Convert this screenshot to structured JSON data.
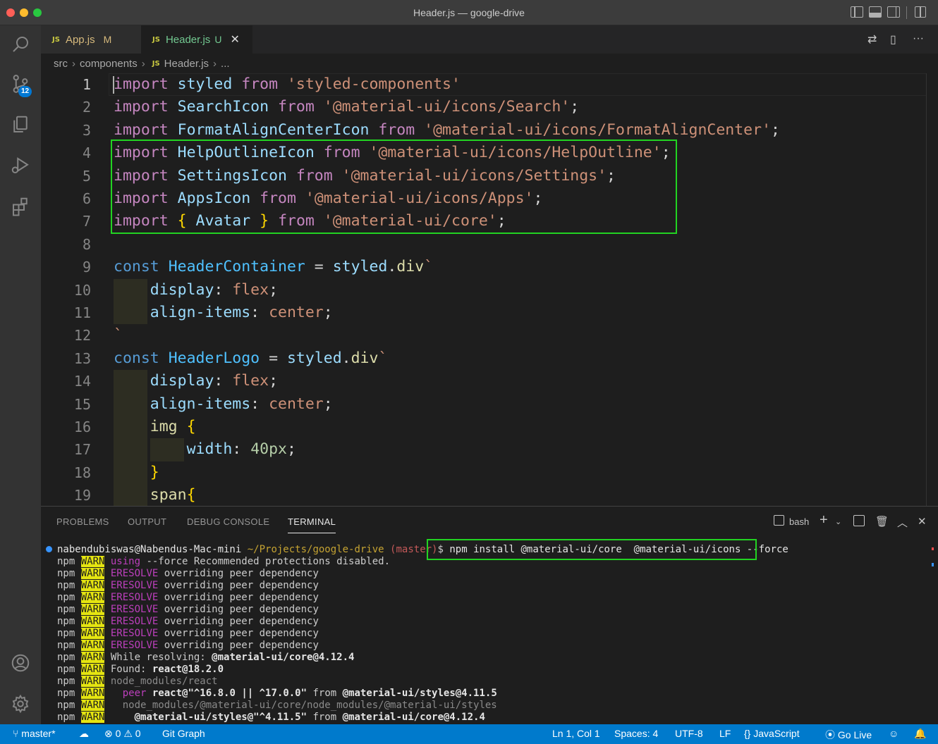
{
  "window": {
    "title": "Header.js — google-drive"
  },
  "activity_bar": {
    "items": [
      {
        "icon": "search-icon"
      },
      {
        "icon": "source-control-icon",
        "badge": "12"
      },
      {
        "icon": "explorer-icon"
      },
      {
        "icon": "run-debug-icon"
      },
      {
        "icon": "extensions-icon"
      },
      {
        "icon": "accounts-icon"
      },
      {
        "icon": "manage-gear-icon"
      }
    ]
  },
  "tabs": [
    {
      "badge": "JS",
      "label": "App.js",
      "status": "M"
    },
    {
      "badge": "JS",
      "label": "Header.js",
      "status": "U",
      "active": true
    }
  ],
  "breadcrumb": {
    "items": [
      "src",
      "components",
      "Header.js",
      "..."
    ],
    "file_badge": "JS"
  },
  "editor": {
    "line_numbers": [
      "1",
      "2",
      "3",
      "4",
      "5",
      "6",
      "7",
      "8",
      "9",
      "10",
      "11",
      "12",
      "13",
      "14",
      "15",
      "16",
      "17",
      "18",
      "19"
    ],
    "lines": [
      [
        [
          "kw",
          "import"
        ],
        [
          "pn",
          " "
        ],
        [
          "id",
          "styled"
        ],
        [
          "pn",
          " "
        ],
        [
          "kw",
          "from"
        ],
        [
          "pn",
          " "
        ],
        [
          "str",
          "'styled-components'"
        ]
      ],
      [
        [
          "kw",
          "import"
        ],
        [
          "pn",
          " "
        ],
        [
          "id",
          "SearchIcon"
        ],
        [
          "pn",
          " "
        ],
        [
          "kw",
          "from"
        ],
        [
          "pn",
          " "
        ],
        [
          "str",
          "'@material-ui/icons/Search'"
        ],
        [
          "pn",
          ";"
        ]
      ],
      [
        [
          "kw",
          "import"
        ],
        [
          "pn",
          " "
        ],
        [
          "id",
          "FormatAlignCenterIcon"
        ],
        [
          "pn",
          " "
        ],
        [
          "kw",
          "from"
        ],
        [
          "pn",
          " "
        ],
        [
          "str",
          "'@material-ui/icons/FormatAlignCenter'"
        ],
        [
          "pn",
          ";"
        ]
      ],
      [
        [
          "kw",
          "import"
        ],
        [
          "pn",
          " "
        ],
        [
          "id",
          "HelpOutlineIcon"
        ],
        [
          "pn",
          " "
        ],
        [
          "kw",
          "from"
        ],
        [
          "pn",
          " "
        ],
        [
          "str",
          "'@material-ui/icons/HelpOutline'"
        ],
        [
          "pn",
          ";"
        ]
      ],
      [
        [
          "kw",
          "import"
        ],
        [
          "pn",
          " "
        ],
        [
          "id",
          "SettingsIcon"
        ],
        [
          "pn",
          " "
        ],
        [
          "kw",
          "from"
        ],
        [
          "pn",
          " "
        ],
        [
          "str",
          "'@material-ui/icons/Settings'"
        ],
        [
          "pn",
          ";"
        ]
      ],
      [
        [
          "kw",
          "import"
        ],
        [
          "pn",
          " "
        ],
        [
          "id",
          "AppsIcon"
        ],
        [
          "pn",
          " "
        ],
        [
          "kw",
          "from"
        ],
        [
          "pn",
          " "
        ],
        [
          "str",
          "'@material-ui/icons/Apps'"
        ],
        [
          "pn",
          ";"
        ]
      ],
      [
        [
          "kw",
          "import"
        ],
        [
          "pn",
          " "
        ],
        [
          "br",
          "{"
        ],
        [
          "pn",
          " "
        ],
        [
          "id",
          "Avatar"
        ],
        [
          "pn",
          " "
        ],
        [
          "br",
          "}"
        ],
        [
          "pn",
          " "
        ],
        [
          "kw",
          "from"
        ],
        [
          "pn",
          " "
        ],
        [
          "str",
          "'@material-ui/core'"
        ],
        [
          "pn",
          ";"
        ]
      ],
      [],
      [
        [
          "st",
          "const"
        ],
        [
          "pn",
          " "
        ],
        [
          "cn",
          "HeaderContainer"
        ],
        [
          "pn",
          " = "
        ],
        [
          "id",
          "styled"
        ],
        [
          "pn",
          "."
        ],
        [
          "fn",
          "div"
        ],
        [
          "tpl",
          "`"
        ]
      ],
      [
        [
          "pn",
          "    "
        ],
        [
          "cssp",
          "display"
        ],
        [
          "pn",
          ": "
        ],
        [
          "cssv",
          "flex"
        ],
        [
          "pn",
          ";"
        ]
      ],
      [
        [
          "pn",
          "    "
        ],
        [
          "cssp",
          "align-items"
        ],
        [
          "pn",
          ": "
        ],
        [
          "cssv",
          "center"
        ],
        [
          "pn",
          ";"
        ]
      ],
      [
        [
          "tpl",
          "`"
        ]
      ],
      [
        [
          "st",
          "const"
        ],
        [
          "pn",
          " "
        ],
        [
          "cn",
          "HeaderLogo"
        ],
        [
          "pn",
          " = "
        ],
        [
          "id",
          "styled"
        ],
        [
          "pn",
          "."
        ],
        [
          "fn",
          "div"
        ],
        [
          "tpl",
          "`"
        ]
      ],
      [
        [
          "pn",
          "    "
        ],
        [
          "cssp",
          "display"
        ],
        [
          "pn",
          ": "
        ],
        [
          "cssv",
          "flex"
        ],
        [
          "pn",
          ";"
        ]
      ],
      [
        [
          "pn",
          "    "
        ],
        [
          "cssp",
          "align-items"
        ],
        [
          "pn",
          ": "
        ],
        [
          "cssv",
          "center"
        ],
        [
          "pn",
          ";"
        ]
      ],
      [
        [
          "pn",
          "    "
        ],
        [
          "fn",
          "img"
        ],
        [
          "pn",
          " "
        ],
        [
          "br",
          "{"
        ]
      ],
      [
        [
          "pn",
          "        "
        ],
        [
          "cssp",
          "width"
        ],
        [
          "pn",
          ": "
        ],
        [
          "num",
          "40px"
        ],
        [
          "pn",
          ";"
        ]
      ],
      [
        [
          "pn",
          "    "
        ],
        [
          "br",
          "}"
        ]
      ],
      [
        [
          "pn",
          "    "
        ],
        [
          "fn",
          "span"
        ],
        [
          "br",
          "{"
        ]
      ]
    ]
  },
  "panel": {
    "tabs": [
      "PROBLEMS",
      "OUTPUT",
      "DEBUG CONSOLE",
      "TERMINAL"
    ],
    "active_tab": "TERMINAL",
    "shell_label": "bash"
  },
  "terminal": {
    "prompt": {
      "user_host": "nabendubiswas@Nabendus-Mac-mini",
      "path": "~/Projects/google-drive",
      "branch": "(master)",
      "symbol": "$",
      "command": "npm install @material-ui/core  @material-ui/icons --force"
    },
    "lines": [
      [
        [
          "n",
          "npm "
        ],
        [
          "w",
          "WARN"
        ],
        [
          "m",
          " using"
        ],
        [
          "n",
          " --force Recommended protections disabled."
        ]
      ],
      [
        [
          "n",
          "npm "
        ],
        [
          "w",
          "WARN"
        ],
        [
          "m",
          " ERESOLVE"
        ],
        [
          "n",
          " overriding peer dependency"
        ]
      ],
      [
        [
          "n",
          "npm "
        ],
        [
          "w",
          "WARN"
        ],
        [
          "m",
          " ERESOLVE"
        ],
        [
          "n",
          " overriding peer dependency"
        ]
      ],
      [
        [
          "n",
          "npm "
        ],
        [
          "w",
          "WARN"
        ],
        [
          "m",
          " ERESOLVE"
        ],
        [
          "n",
          " overriding peer dependency"
        ]
      ],
      [
        [
          "n",
          "npm "
        ],
        [
          "w",
          "WARN"
        ],
        [
          "m",
          " ERESOLVE"
        ],
        [
          "n",
          " overriding peer dependency"
        ]
      ],
      [
        [
          "n",
          "npm "
        ],
        [
          "w",
          "WARN"
        ],
        [
          "m",
          " ERESOLVE"
        ],
        [
          "n",
          " overriding peer dependency"
        ]
      ],
      [
        [
          "n",
          "npm "
        ],
        [
          "w",
          "WARN"
        ],
        [
          "m",
          " ERESOLVE"
        ],
        [
          "n",
          " overriding peer dependency"
        ]
      ],
      [
        [
          "n",
          "npm "
        ],
        [
          "w",
          "WARN"
        ],
        [
          "m",
          " ERESOLVE"
        ],
        [
          "n",
          " overriding peer dependency"
        ]
      ],
      [
        [
          "n",
          "npm "
        ],
        [
          "w",
          "WARN"
        ],
        [
          "n",
          " While resolving: "
        ],
        [
          "b",
          "@material-ui/core@4.12.4"
        ]
      ],
      [
        [
          "n",
          "npm "
        ],
        [
          "w",
          "WARN"
        ],
        [
          "n",
          " Found: "
        ],
        [
          "b",
          "react@18.2.0"
        ]
      ],
      [
        [
          "n",
          "npm "
        ],
        [
          "w",
          "WARN"
        ],
        [
          "d",
          " node_modules/react"
        ]
      ],
      [
        [
          "n",
          "npm "
        ],
        [
          "w",
          "WARN"
        ],
        [
          "m",
          "   peer"
        ],
        [
          "b",
          " react@\"^16.8.0 || ^17.0.0\""
        ],
        [
          "n",
          " from "
        ],
        [
          "b",
          "@material-ui/styles@4.11.5"
        ]
      ],
      [
        [
          "n",
          "npm "
        ],
        [
          "w",
          "WARN"
        ],
        [
          "d",
          "   node_modules/@material-ui/core/node_modules/@material-ui/styles"
        ]
      ],
      [
        [
          "n",
          "npm "
        ],
        [
          "w",
          "WARN"
        ],
        [
          "b",
          "     @material-ui/styles@\"^4.11.5\""
        ],
        [
          "n",
          " from "
        ],
        [
          "b",
          "@material-ui/core@4.12.4"
        ]
      ]
    ]
  },
  "status_bar": {
    "branch": "master*",
    "errors": "0",
    "warnings": "0",
    "git_graph": "Git Graph",
    "position": "Ln 1, Col 1",
    "spaces": "Spaces: 4",
    "encoding": "UTF-8",
    "eol": "LF",
    "language": "JavaScript",
    "go_live": "Go Live"
  }
}
